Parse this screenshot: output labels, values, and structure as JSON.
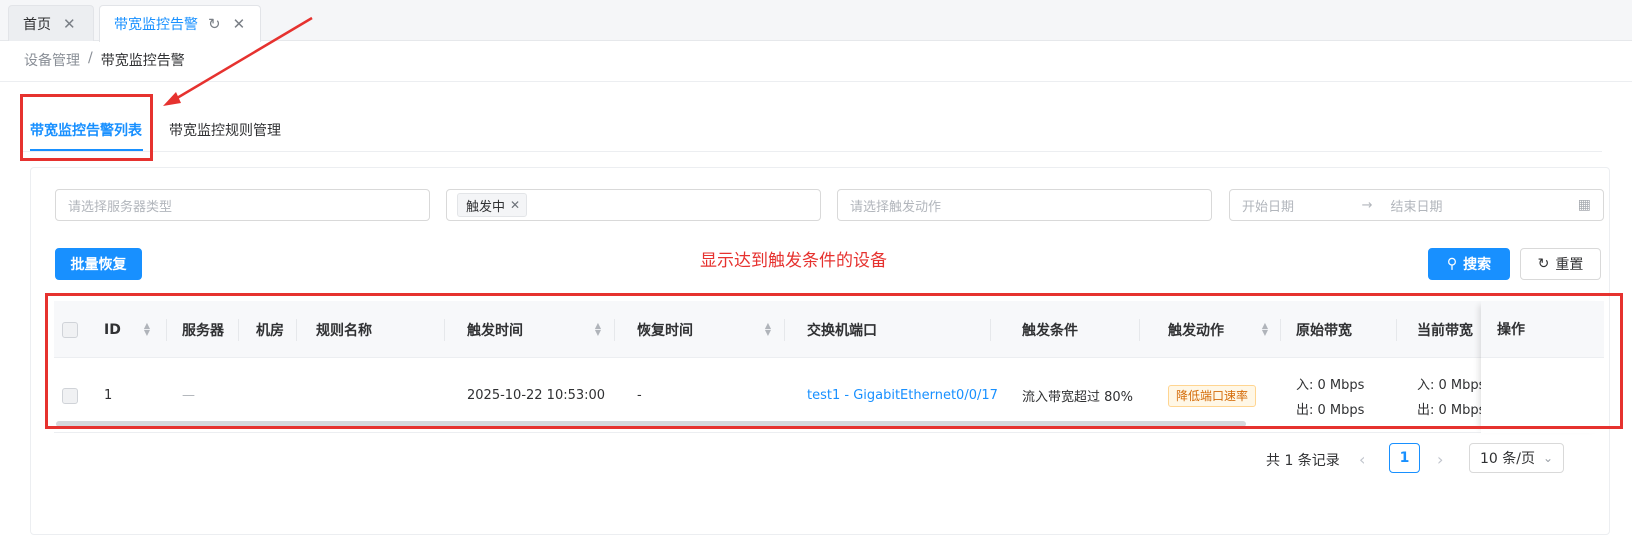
{
  "tabs": [
    {
      "label": "首页",
      "active": false
    },
    {
      "label": "带宽监控告警",
      "active": true
    }
  ],
  "breadcrumb": {
    "parent": "设备管理",
    "separator": "/",
    "current": "带宽监控告警"
  },
  "inner_tabs": [
    {
      "label": "带宽监控告警列表",
      "active": true
    },
    {
      "label": "带宽监控规则管理",
      "active": false
    }
  ],
  "filters": {
    "server_type_placeholder": "请选择服务器类型",
    "status_tag": "触发中",
    "action_placeholder": "请选择触发动作",
    "start_date_placeholder": "开始日期",
    "end_date_placeholder": "结束日期",
    "date_separator": "→"
  },
  "buttons": {
    "batch_restore": "批量恢复",
    "search": "搜索",
    "reset": "重置"
  },
  "annotation": "显示达到触发条件的设备",
  "table": {
    "columns": [
      "ID",
      "服务器",
      "机房",
      "规则名称",
      "触发时间",
      "恢复时间",
      "交换机端口",
      "触发条件",
      "触发动作",
      "原始带宽",
      "当前带宽",
      "操作"
    ],
    "rows": [
      {
        "id": "1",
        "server": "—",
        "room": "",
        "rule_name": "",
        "trigger_time": "2025-10-22 10:53:00",
        "restore_time": "-",
        "switch_port": "test1 - GigabitEthernet0/0/17",
        "condition": "流入带宽超过 80%",
        "action": "降低端口速率",
        "original_in": "入: 0 Mbps",
        "original_out": "出: 0 Mbps",
        "current_in": "入: 0 Mbps",
        "current_out": "出: 0 Mbps"
      }
    ]
  },
  "pagination": {
    "total_text": "共 1 条记录",
    "current_page": "1",
    "page_size": "10 条/页",
    "prev_icon": "‹",
    "next_icon": "›"
  },
  "colors": {
    "primary": "#1890ff",
    "annotation": "#e6322f",
    "tag_warning": "#d46b08"
  }
}
